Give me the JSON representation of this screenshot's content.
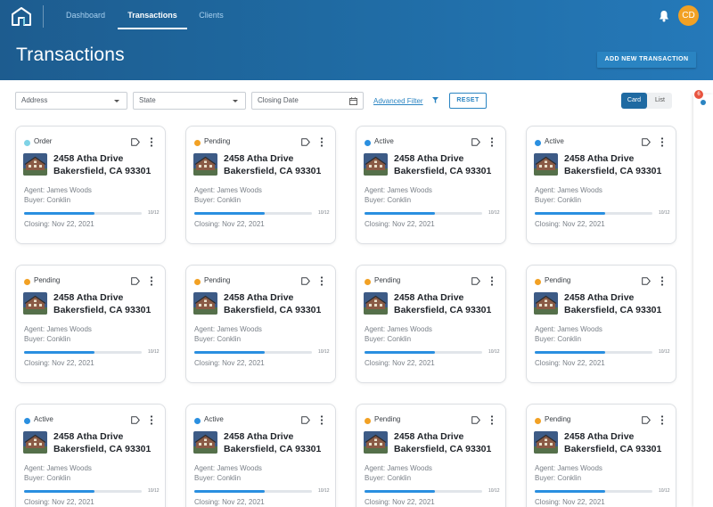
{
  "header": {
    "nav": [
      "Dashboard",
      "Transactions",
      "Clients"
    ],
    "active_tab": "Transactions",
    "avatar_initials": "CD",
    "page_title": "Transactions",
    "add_button": "ADD NEW TRANSACTION",
    "icons": [
      "home-logo-icon",
      "bell-icon"
    ],
    "colors": {
      "header_start": "#1d5c8f",
      "header_end": "#2579b9",
      "accent": "#2a84c2",
      "avatar_bg": "#f2a124"
    }
  },
  "filters": {
    "address_placeholder": "Address",
    "state_placeholder": "State",
    "closing_date_placeholder": "Closing Date",
    "advanced_filter": "Advanced Filter",
    "reset": "RESET",
    "view_toggle": [
      "Card",
      "List"
    ],
    "active_view": "Card"
  },
  "side_panel": {
    "badge_count": "6"
  },
  "status_colors": {
    "Order": "#7fd3e6",
    "Pending": "#f2a124",
    "Active": "#2a8fe0"
  },
  "cards": [
    {
      "status": "Order",
      "address_line1": "2458 Atha Drive",
      "address_line2": "Bakersfield, CA 93301",
      "agent": "Agent: James Woods",
      "buyer": "Buyer: Conklin",
      "progress_label": "10/12",
      "progress": 0.6,
      "closing": "Closing: Nov 22, 2021"
    },
    {
      "status": "Pending",
      "address_line1": "2458 Atha Drive",
      "address_line2": "Bakersfield, CA 93301",
      "agent": "Agent: James Woods",
      "buyer": "Buyer: Conklin",
      "progress_label": "10/12",
      "progress": 0.6,
      "closing": "Closing: Nov 22, 2021"
    },
    {
      "status": "Active",
      "address_line1": "2458 Atha Drive",
      "address_line2": "Bakersfield, CA 93301",
      "agent": "Agent: James Woods",
      "buyer": "Buyer: Conklin",
      "progress_label": "10/12",
      "progress": 0.6,
      "closing": "Closing: Nov 22, 2021"
    },
    {
      "status": "Active",
      "address_line1": "2458 Atha Drive",
      "address_line2": "Bakersfield, CA 93301",
      "agent": "Agent: James Woods",
      "buyer": "Buyer: Conklin",
      "progress_label": "10/12",
      "progress": 0.6,
      "closing": "Closing: Nov 22, 2021"
    },
    {
      "status": "Pending",
      "address_line1": "2458 Atha Drive",
      "address_line2": "Bakersfield, CA 93301",
      "agent": "Agent: James Woods",
      "buyer": "Buyer: Conklin",
      "progress_label": "10/12",
      "progress": 0.6,
      "closing": "Closing: Nov 22, 2021"
    },
    {
      "status": "Pending",
      "address_line1": "2458 Atha Drive",
      "address_line2": "Bakersfield, CA 93301",
      "agent": "Agent: James Woods",
      "buyer": "Buyer: Conklin",
      "progress_label": "10/12",
      "progress": 0.6,
      "closing": "Closing: Nov 22, 2021"
    },
    {
      "status": "Pending",
      "address_line1": "2458 Atha Drive",
      "address_line2": "Bakersfield, CA 93301",
      "agent": "Agent: James Woods",
      "buyer": "Buyer: Conklin",
      "progress_label": "10/12",
      "progress": 0.6,
      "closing": "Closing: Nov 22, 2021"
    },
    {
      "status": "Pending",
      "address_line1": "2458 Atha Drive",
      "address_line2": "Bakersfield, CA 93301",
      "agent": "Agent: James Woods",
      "buyer": "Buyer: Conklin",
      "progress_label": "10/12",
      "progress": 0.6,
      "closing": "Closing: Nov 22, 2021"
    },
    {
      "status": "Active",
      "address_line1": "2458 Atha Drive",
      "address_line2": "Bakersfield, CA 93301",
      "agent": "Agent: James Woods",
      "buyer": "Buyer: Conklin",
      "progress_label": "10/12",
      "progress": 0.6,
      "closing": "Closing: Nov 22, 2021"
    },
    {
      "status": "Active",
      "address_line1": "2458 Atha Drive",
      "address_line2": "Bakersfield, CA 93301",
      "agent": "Agent: James Woods",
      "buyer": "Buyer: Conklin",
      "progress_label": "10/12",
      "progress": 0.6,
      "closing": "Closing: Nov 22, 2021"
    },
    {
      "status": "Pending",
      "address_line1": "2458 Atha Drive",
      "address_line2": "Bakersfield, CA 93301",
      "agent": "Agent: James Woods",
      "buyer": "Buyer: Conklin",
      "progress_label": "10/12",
      "progress": 0.6,
      "closing": "Closing: Nov 22, 2021"
    },
    {
      "status": "Pending",
      "address_line1": "2458 Atha Drive",
      "address_line2": "Bakersfield, CA 93301",
      "agent": "Agent: James Woods",
      "buyer": "Buyer: Conklin",
      "progress_label": "10/12",
      "progress": 0.6,
      "closing": "Closing: Nov 22, 2021"
    }
  ]
}
